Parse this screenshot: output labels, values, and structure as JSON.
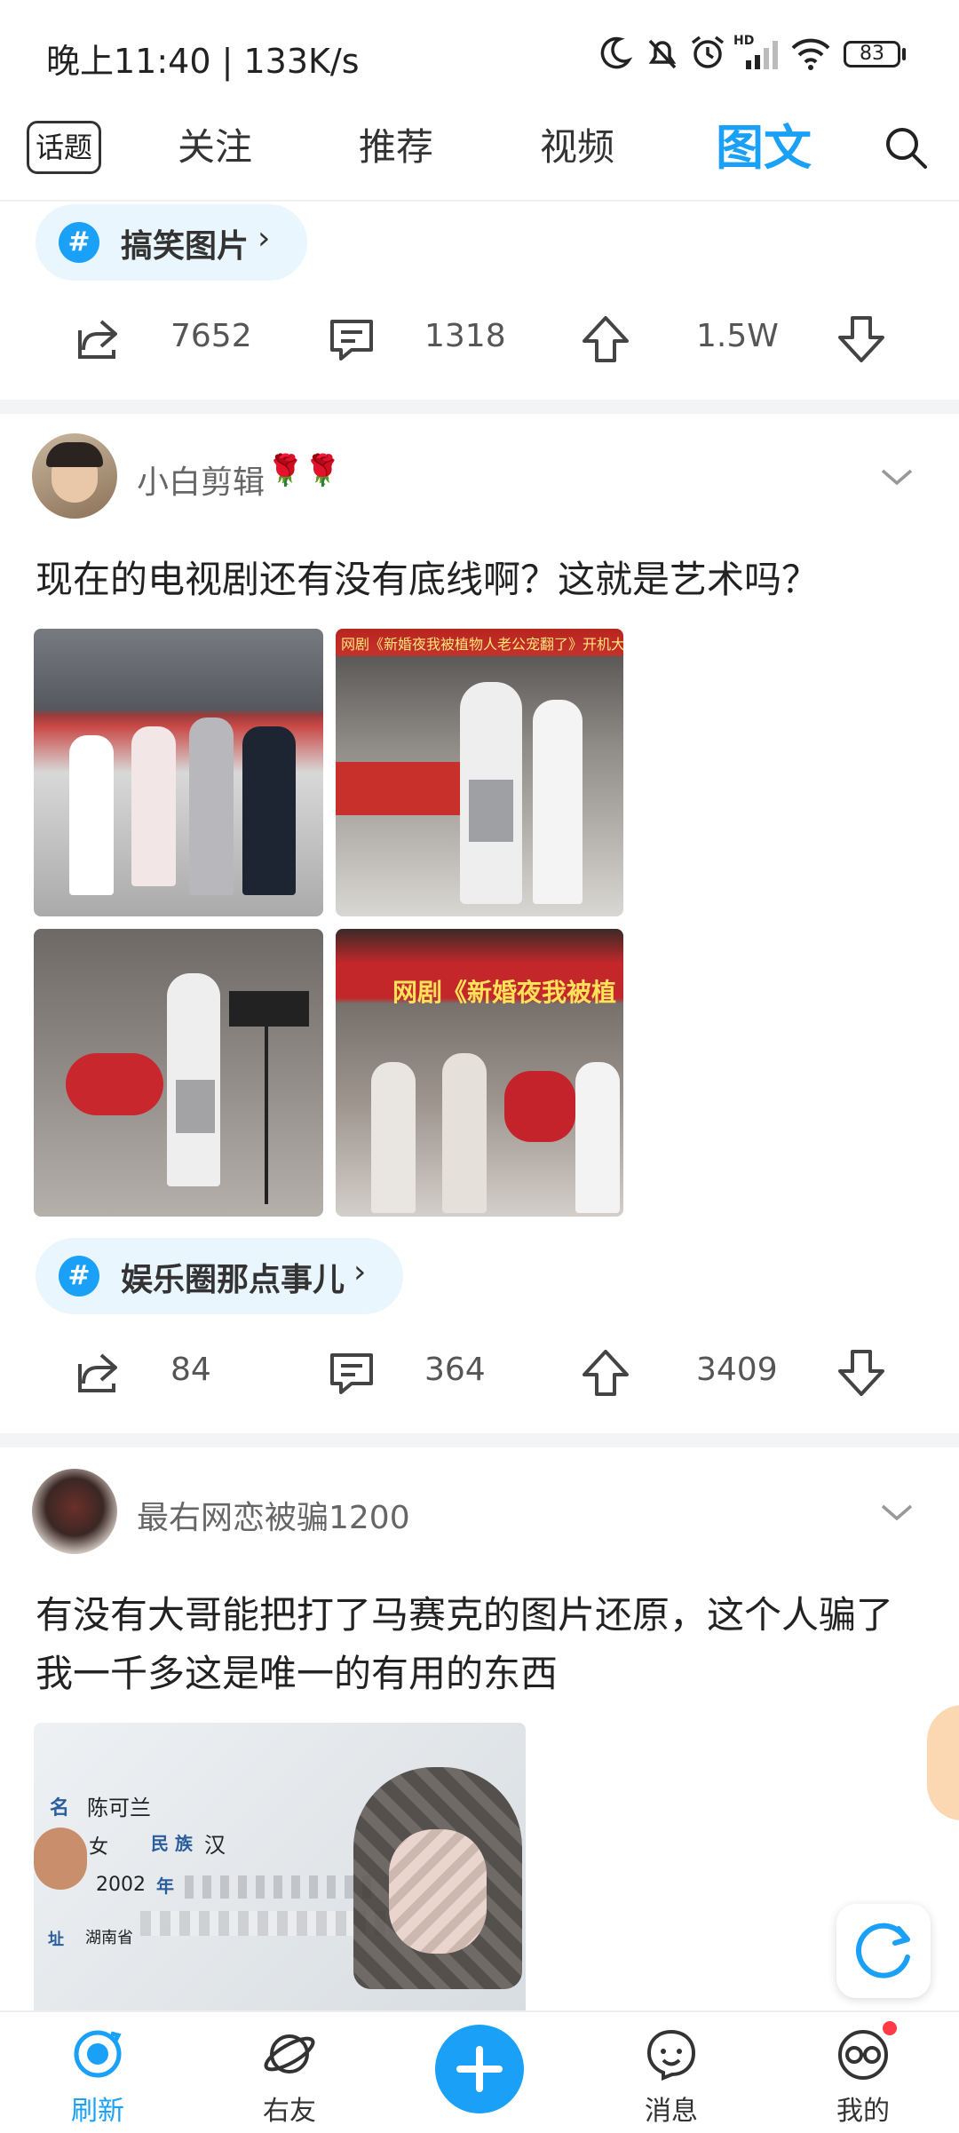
{
  "status_bar": {
    "time": "晚上11:40 | 133K/s",
    "battery": "83"
  },
  "top_nav": {
    "topic_button": "话题",
    "tabs": [
      {
        "label": "关注",
        "active": false
      },
      {
        "label": "推荐",
        "active": false
      },
      {
        "label": "视频",
        "active": false
      },
      {
        "label": "图文",
        "active": true
      }
    ]
  },
  "post0": {
    "topic": "搞笑图片",
    "shares": "7652",
    "comments": "1318",
    "upvotes": "1.5W"
  },
  "post1": {
    "author": "小白剪辑",
    "author_emoji": "🌹🌹",
    "title": "现在的电视剧还有没有底线啊？这就是艺术吗？",
    "image_banner_text": [
      "网剧《新婚夜我被植物人老公宠翻了》开机大吉",
      "网剧《新婚夜我被植"
    ],
    "topic": "娱乐圈那点事儿",
    "shares": "84",
    "comments": "364",
    "upvotes": "3409"
  },
  "post2": {
    "author": "最右网恋被骗1200",
    "title": "有没有大哥能把打了马赛克的图片还原，这个人骗了我一千多这是唯一的有用的东西",
    "id_card": {
      "name_label": "名",
      "name": "陈可兰",
      "sex_value": "女",
      "ethnic_label": "民 族",
      "ethnic": "汉",
      "year": "2002",
      "year_label": "年",
      "addr_label": "址",
      "addr": "湖南省"
    }
  },
  "bottom_nav": [
    {
      "label": "刷新",
      "active": true
    },
    {
      "label": "右友",
      "active": false
    },
    {
      "label": "",
      "active": false
    },
    {
      "label": "消息",
      "active": false
    },
    {
      "label": "我的",
      "active": false
    }
  ],
  "colors": {
    "accent": "#1aa1f7",
    "chip_bg": "#eaf6fd",
    "divider": "#f3f4f6"
  }
}
